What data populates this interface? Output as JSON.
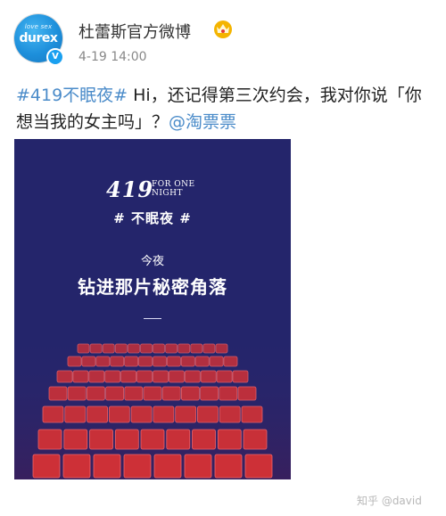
{
  "post": {
    "username": "杜蕾斯官方微博",
    "time": "4-19 14:00",
    "hashtag": "#419不眠夜#",
    "text_part1": " Hi，还记得第三次约会，我对你说「你想当我的女主吗」？",
    "mention": "@淘票票"
  },
  "avatar": {
    "tagline": "love sex",
    "brand": "durex",
    "verified": "V"
  },
  "poster": {
    "big_number": "419",
    "for_one": "FOR ONE",
    "night": "NIGHT",
    "hashtag": "# 不眠夜 #",
    "tonight": "今夜",
    "main": "钻进那片秘密角落"
  },
  "watermark": "知乎 @david",
  "colors": {
    "link": "#4a8bc9",
    "poster_bg": "#24256b",
    "seat": "#d93234"
  },
  "icons": {
    "crown": "crown-badge-icon",
    "verified": "verified-icon"
  }
}
